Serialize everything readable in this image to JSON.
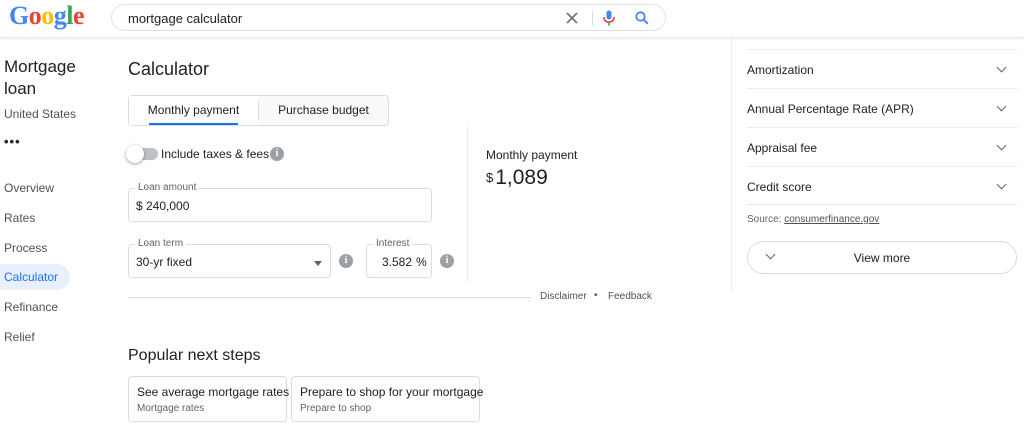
{
  "header": {
    "logo_letters": [
      {
        "ch": "G",
        "color": "#4285f4"
      },
      {
        "ch": "o",
        "color": "#ea4335"
      },
      {
        "ch": "o",
        "color": "#fbbc05"
      },
      {
        "ch": "g",
        "color": "#4285f4"
      },
      {
        "ch": "l",
        "color": "#34a853"
      },
      {
        "ch": "e",
        "color": "#ea4335"
      }
    ],
    "search_query": "mortgage calculator",
    "clear_icon": "close-icon",
    "voice_icon": "microphone-icon",
    "search_icon": "search-icon"
  },
  "sidebar": {
    "title": "Mortgage loan",
    "subtitle": "United States",
    "more": "•••",
    "items": [
      {
        "label": "Overview",
        "active": false
      },
      {
        "label": "Rates",
        "active": false
      },
      {
        "label": "Process",
        "active": false
      },
      {
        "label": "Calculator",
        "active": true
      },
      {
        "label": "Refinance",
        "active": false
      },
      {
        "label": "Relief",
        "active": false
      }
    ]
  },
  "calculator": {
    "title": "Calculator",
    "tabs": [
      {
        "label": "Monthly payment",
        "active": true
      },
      {
        "label": "Purchase budget",
        "active": false
      }
    ],
    "toggle_label": "Include taxes & fees",
    "toggle_on": false,
    "loan_amount": {
      "label": "Loan amount",
      "value": "$ 240,000"
    },
    "loan_term": {
      "label": "Loan term",
      "value": "30-yr fixed"
    },
    "interest": {
      "label": "Interest",
      "value": "3.582",
      "unit": "%"
    },
    "monthly_payment": {
      "label": "Monthly payment",
      "currency": "$",
      "amount": "1,089"
    },
    "footer": {
      "disclaimer": "Disclaimer",
      "separator": "•",
      "feedback": "Feedback"
    }
  },
  "next_steps": {
    "title": "Popular next steps",
    "cards": [
      {
        "title": "See average mortgage rates",
        "subtitle": "Mortgage rates"
      },
      {
        "title": "Prepare to shop for your mortgage",
        "subtitle": "Prepare to shop"
      }
    ]
  },
  "right_panel": {
    "accordion": [
      {
        "label": "Amortization"
      },
      {
        "label": "Annual Percentage Rate (APR)"
      },
      {
        "label": "Appraisal fee"
      },
      {
        "label": "Credit score"
      }
    ],
    "source_prefix": "Source: ",
    "source_link": "consumerfinance.gov",
    "view_more": "View more"
  },
  "colors": {
    "accent": "#1a73e8",
    "active_nav_bg": "#e8f0fe",
    "border": "#dadce0"
  }
}
